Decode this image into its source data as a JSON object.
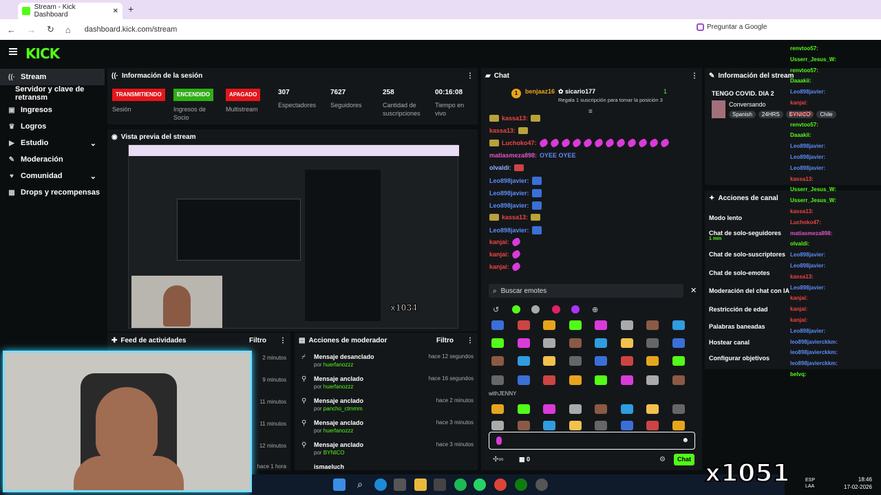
{
  "browser": {
    "tab_title": "Stream - Kick Dashboard",
    "url": "dashboard.kick.com/stream",
    "google_button": "Preguntar a Google"
  },
  "logo": "KICK",
  "sidebar": {
    "items": [
      {
        "label": "Stream",
        "icon": "signal-icon"
      },
      {
        "label": "Servidor y clave de retransm",
        "icon": ""
      },
      {
        "label": "Ingresos",
        "icon": "money-icon"
      },
      {
        "label": "Logros",
        "icon": "trophy-icon"
      },
      {
        "label": "Estudio",
        "icon": "video-icon"
      },
      {
        "label": "Moderación",
        "icon": "wrench-icon"
      },
      {
        "label": "Comunidad",
        "icon": "heart-icon"
      },
      {
        "label": "Drops y recompensas",
        "icon": "grid-icon"
      }
    ]
  },
  "session": {
    "title": "Información de la sesión",
    "stats": [
      {
        "badge": "TRANSMITIENDO",
        "label": "Sesión"
      },
      {
        "badge": "ENCENDIDO",
        "label": "Ingresos de Socio"
      },
      {
        "badge": "APAGADO",
        "label": "Multistream"
      },
      {
        "value": "307",
        "label": "Espectadores"
      },
      {
        "value": "7627",
        "label": "Seguidores"
      },
      {
        "value": "258",
        "label": "Cantidad de suscripciones"
      },
      {
        "value": "00:16:08",
        "label": "Tiempo en vivo"
      }
    ]
  },
  "preview": {
    "title": "Vista previa del stream",
    "counter": "x1034"
  },
  "feed": {
    "title": "Feed de actividades",
    "filter": "Filtro",
    "times": [
      "2 minutos",
      "9 minutos",
      "11 minutos",
      "11 minutos",
      "12 minutos",
      "hace 1 hora"
    ]
  },
  "mod_actions": {
    "title": "Acciones de moderador",
    "filter": "Filtro",
    "rows": [
      {
        "action": "Mensaje desanclado",
        "by": "huerfanozzz",
        "time": "hace 12 segundos"
      },
      {
        "action": "Mensaje anclado",
        "by": "huerfanozzz",
        "time": "hace 16 segundos"
      },
      {
        "action": "Mensaje anclado",
        "by": "pancho_ctmmm",
        "time": "hace 2 minutos"
      },
      {
        "action": "Mensaje anclado",
        "by": "huerfanozzz",
        "time": "hace 3 minutos"
      },
      {
        "action": "Mensaje anclado",
        "by": "BYNICO",
        "time": "hace 3 minutos"
      },
      {
        "action": "ismaeluch",
        "by": "",
        "time": ""
      }
    ],
    "by_prefix": "por"
  },
  "chat": {
    "title": "Chat",
    "pinned_user": "benjaaz16",
    "pinned_target": "sicario177",
    "pinned_count": "1",
    "pinned_text": "Regala 1 suscripción para tomar la posición 3",
    "messages": [
      {
        "user": "kassa13:"
      },
      {
        "user": "kassa13:"
      },
      {
        "user": "Luchoko47:"
      },
      {
        "user": "matiasmeza898:",
        "text": "OYEE OYEE"
      },
      {
        "user": "olvaldi:"
      },
      {
        "user": "Leo898javier:"
      },
      {
        "user": "Leo898javier:"
      },
      {
        "user": "Leo898javier:"
      },
      {
        "user": "kassa13:"
      },
      {
        "user": "Leo898javier:"
      },
      {
        "user": "kanjai:"
      },
      {
        "user": "kanjai:"
      },
      {
        "user": "kanjai:"
      }
    ],
    "search_placeholder": "Buscar emotes",
    "section_label": "withJENNY",
    "input_value": "",
    "points": "0",
    "send_button": "Chat"
  },
  "info": {
    "title": "Información del stream",
    "stream_title": "TENGO COVID. DIA 2",
    "category": "Conversando",
    "tags": [
      "Spanish",
      "24HRS",
      "BYNICO",
      "Chile"
    ]
  },
  "actions": {
    "title": "Acciones de canal",
    "items": [
      "Modo lento",
      "Chat de solo-seguidores",
      "Chat de solo-suscriptores",
      "Chat de solo-emotes",
      "Moderación del chat con IA",
      "Restricción de edad",
      "Palabras baneadas",
      "Hostear canal",
      "Configurar objetivos"
    ],
    "followers_sub": "1 min"
  },
  "overlay_chat": [
    "renvtoo57:",
    "Usserr_Jesus_W:",
    "renvtoo57:",
    "Daaakii:",
    "Leo898javier:",
    "kanjai:",
    "kassa13:",
    "renvtoo57:",
    "Daaakii:",
    "Leo898javier:",
    "Leo898javier:",
    "Leo898javier:",
    "kassa13:",
    "Usserr_Jesus_W:",
    "Usserr_Jesus_W:",
    "kassa13:",
    "Luchoko47:",
    "matiasmeza898:",
    "olvaldi:",
    "Leo898javier:",
    "Leo898javier:",
    "kassa13:",
    "Leo898javier:",
    "kanjai:",
    "kanjai:",
    "kanjai:",
    "Leo898javier:",
    "leo898javierckkm:",
    "leo898javierckkm:",
    "leo898javierckkm:",
    "belvq:"
  ],
  "overlay_counter": "x1051",
  "clock": {
    "time": "18:46",
    "date": "17-02-2026",
    "lang": "ESP LAA"
  }
}
